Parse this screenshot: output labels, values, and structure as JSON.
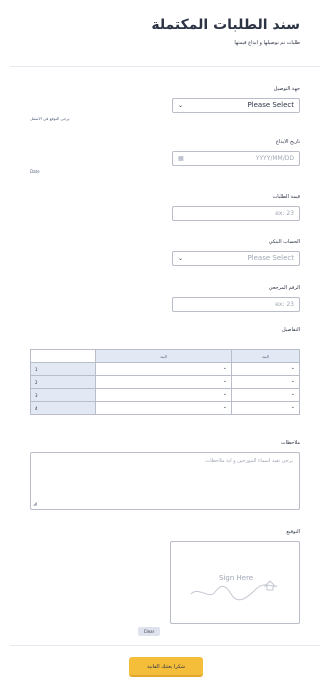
{
  "header": {
    "title": "سند الطلبات المكتملة",
    "subtitle": "طلبات تم توصيلها و ايداع قيمتها"
  },
  "fields": {
    "delivery": {
      "label": "جهة التوصيل",
      "value": "Please Select",
      "sublabel": "يرجى التوقع في الاسفل"
    },
    "deposit_date": {
      "label": "تاريخ الايداع",
      "placeholder": "YYYY/MM/DD",
      "sublabel": "Date"
    },
    "orders_value": {
      "label": "قيمة الطلبات",
      "placeholder": "ex: 23"
    },
    "bank_account": {
      "label": "الحساب البنكي",
      "placeholder": "Please Select"
    },
    "reference": {
      "label": "الرقم المرجعي",
      "placeholder": "ex: 23"
    },
    "details": {
      "label": "التفاصيل",
      "columns": [
        "البند",
        "البند"
      ],
      "rows": [
        "1",
        "2",
        "3",
        "4"
      ]
    },
    "notes": {
      "label": "ملاحظات",
      "placeholder": "يرجى تقيد اسماء المورحين و اية ملاحظات"
    },
    "signature": {
      "label": "التوقيع",
      "hint": "Sign Here",
      "clear": "Clear"
    }
  },
  "submit": {
    "label": "شكرا بعثتك الفاتية"
  },
  "colors": {
    "accent": "#f4bd3a",
    "header_cell": "#e3e8f5",
    "border": "#b8bdc9"
  }
}
